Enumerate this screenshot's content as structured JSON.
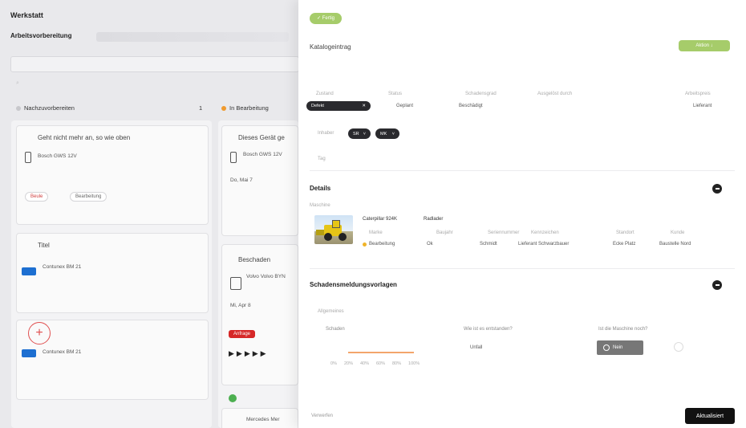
{
  "board": {
    "title": "Werkstatt",
    "subtitle": "Arbeitsvorbereitung",
    "column_todo": {
      "label": "Nachzuvorbereiten",
      "count": "1"
    },
    "column_doing": {
      "label": "In Bearbeitung"
    },
    "card1": {
      "title": "Geht nicht mehr an, so wie oben",
      "device": "Bosch GWS 12V",
      "tag1": "Beule",
      "tag2": "Bearbeitung"
    },
    "card2": {
      "title": "Titel",
      "device": "Contunex BM 21"
    },
    "card3": {
      "device": "Contunex BM 21"
    },
    "card4": {
      "title": "Dieses Gerät ge",
      "device": "Bosch GWS 12V",
      "date": "Do, Mai 7"
    },
    "card5": {
      "title": "Beschaden",
      "device": "Volvo Volvo BYN",
      "date": "Mi, Apr 8",
      "button": "Anfrage"
    },
    "card6": {
      "device": "Mercedes Mer"
    }
  },
  "panel": {
    "status_pill": "✓ Fertig",
    "title": "Katalogeintrag",
    "header_action": "Aktion ↓",
    "filter_labels": [
      "Zustand",
      "Status",
      "Schadensgrad",
      "Ausgelöst durch",
      "Arbeitspreis"
    ],
    "filter_values": [
      "Defekt",
      "Geplant",
      "Beschädigt",
      "Lieferant"
    ],
    "owner_label": "Inhaber",
    "owner_chips": [
      "SR",
      "MK"
    ],
    "tags_label": "Tag",
    "details": {
      "title": "Details",
      "section_label": "Maschine",
      "machine_name": "Caterpillar 924K",
      "machine_badge": "Radlader",
      "meta_labels": [
        "Marke",
        "Baujahr",
        "Seriennummer",
        "Kennzeichen",
        "Standort",
        "Kunde"
      ],
      "meta_values": [
        "Bearbeitung",
        "Ok",
        "Schmidt",
        "Lieferant Schwarzbauer",
        "Ecke Platz",
        "Baustelle Nord"
      ]
    },
    "damage": {
      "title": "Schadensmeldungsvorlagen",
      "section_label": "Allgemeines",
      "field1_label": "Schaden",
      "field2_label": "Wie ist es entstanden?",
      "field2_value": "Unfall",
      "field3_label": "Ist die Maschine noch?",
      "field3_button": "Nein",
      "slider_ticks": [
        "0%",
        "20%",
        "40%",
        "60%",
        "80%",
        "100%"
      ]
    },
    "footer_link": "Verwerfen",
    "submit": "Aktualisiert"
  }
}
